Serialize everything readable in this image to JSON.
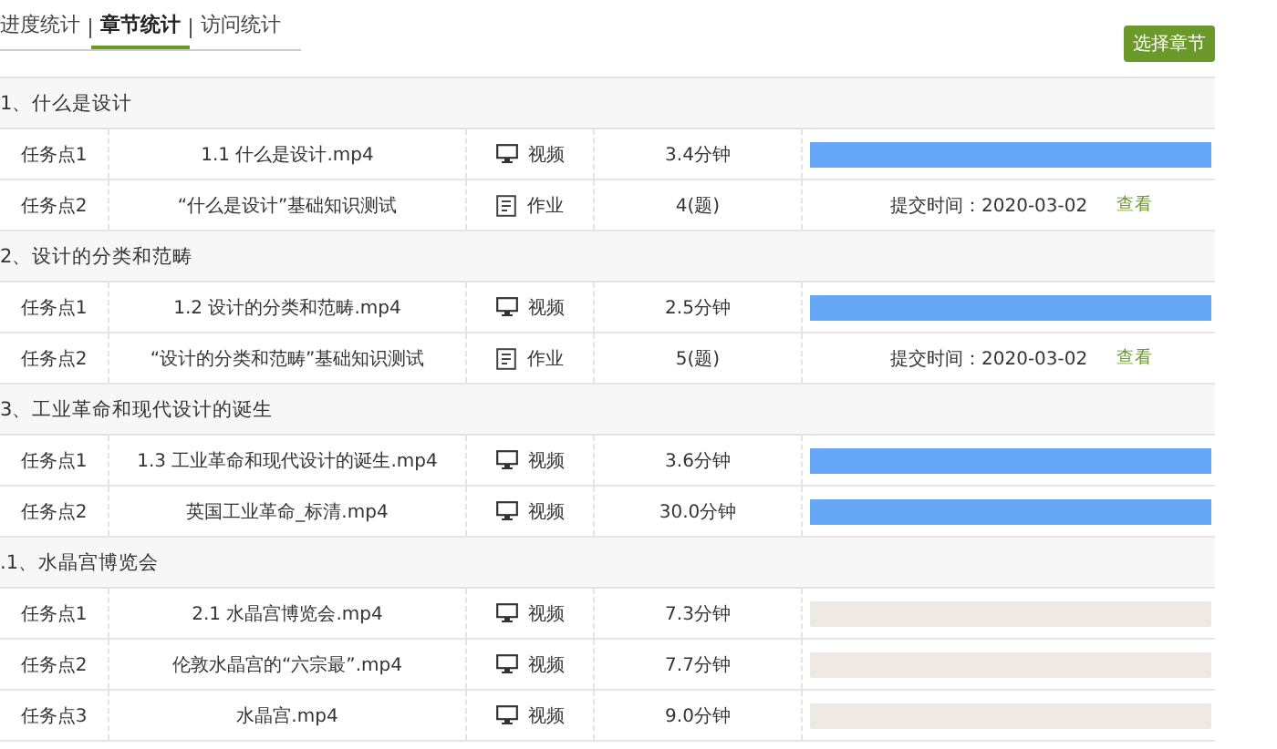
{
  "tabs": [
    {
      "label": "进度统计",
      "selected": false
    },
    {
      "label": "章节统计",
      "selected": true
    },
    {
      "label": "访问统计",
      "selected": false
    }
  ],
  "select_button": "选择章节",
  "sections": [
    {
      "title": "1、什么是设计",
      "tasks": [
        {
          "kind": "video",
          "point": "任务点1",
          "name": "1.1 什么是设计.mp4",
          "type": "视频",
          "amount": "3.4分钟",
          "level": 1
        },
        {
          "kind": "quiz",
          "point": "任务点2",
          "name": "“什么是设计”基础知识测试",
          "type": "作业",
          "amount": "4(题)",
          "submitted": "提交时间：2020-03-02",
          "action": "查看"
        }
      ]
    },
    {
      "title": "2、设计的分类和范畴",
      "tasks": [
        {
          "kind": "video",
          "point": "任务点1",
          "name": "1.2 设计的分类和范畴.mp4",
          "type": "视频",
          "amount": "2.5分钟",
          "level": 1
        },
        {
          "kind": "quiz",
          "point": "任务点2",
          "name": "“设计的分类和范畴”基础知识测试",
          "type": "作业",
          "amount": "5(题)",
          "submitted": "提交时间：2020-03-02",
          "action": "查看"
        }
      ]
    },
    {
      "title": "3、工业革命和现代设计的诞生",
      "tasks": [
        {
          "kind": "video",
          "point": "任务点1",
          "name": "1.3 工业革命和现代设计的诞生.mp4",
          "type": "视频",
          "amount": "3.6分钟",
          "level": 1
        },
        {
          "kind": "video",
          "point": "任务点2",
          "name": "英国工业革命_标清.mp4",
          "type": "视频",
          "amount": "30.0分钟",
          "level": 1
        }
      ]
    },
    {
      "title": ".1、水晶宫博览会",
      "tasks": [
        {
          "kind": "video",
          "point": "任务点1",
          "name": "2.1 水晶宫博览会.mp4",
          "type": "视频",
          "amount": "7.3分钟",
          "level": 0
        },
        {
          "kind": "video",
          "point": "任务点2",
          "name": "伦敦水晶宫的“六宗最”.mp4",
          "type": "视频",
          "amount": "7.7分钟",
          "level": 0
        },
        {
          "kind": "video",
          "point": "任务点3",
          "name": "水晶宫.mp4",
          "type": "视频",
          "amount": "9.0分钟",
          "level": 0
        }
      ]
    }
  ]
}
